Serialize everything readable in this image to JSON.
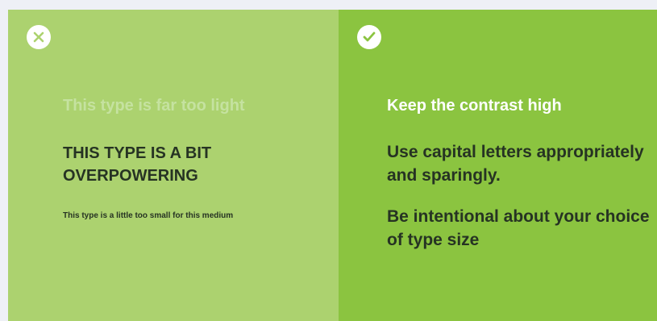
{
  "left_panel": {
    "badge_icon": "x-icon",
    "light_text": "This type is far too light",
    "caps_text": "THIS TYPE IS A BIT OVERPOWERING",
    "small_text": "This type is a little too small for this medium",
    "background": "#acd26f"
  },
  "right_panel": {
    "badge_icon": "checkmark-icon",
    "tip_1": "Keep the contrast high",
    "tip_2": "Use capital letters appropriately and sparingly.",
    "tip_3": "Be intentional about your choice of type size",
    "background": "#8bc440"
  }
}
